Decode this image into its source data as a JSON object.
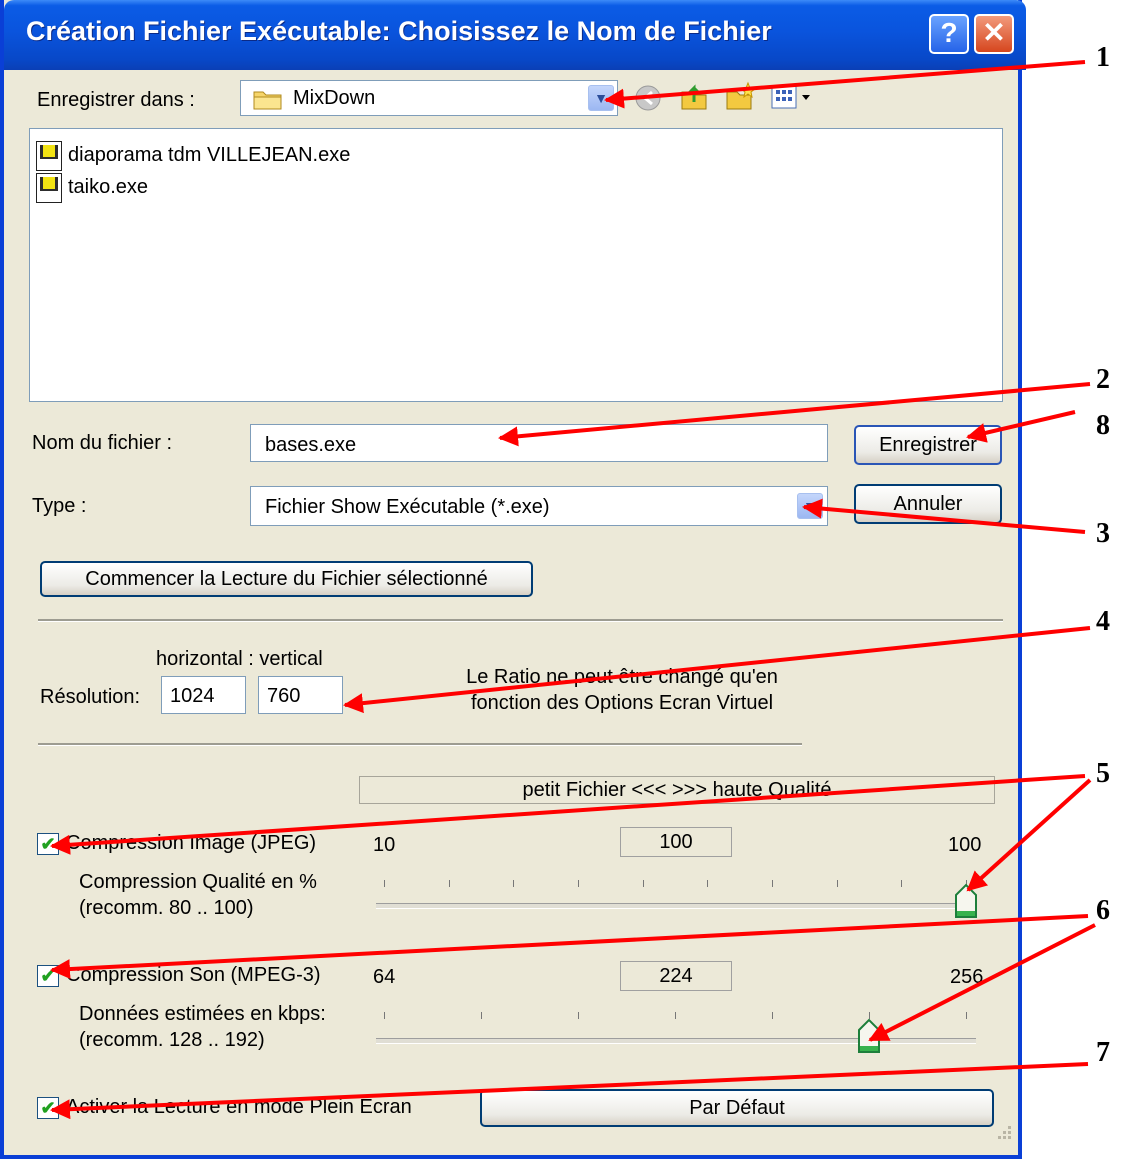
{
  "window": {
    "title": "Création Fichier Exécutable: Choisissez le Nom de Fichier",
    "help_glyph": "?",
    "close_glyph": "✕"
  },
  "save_in": {
    "label": "Enregistrer dans :",
    "folder": "MixDown",
    "icons": [
      "back-arrow-icon",
      "up-folder-icon",
      "new-folder-icon",
      "view-menu-icon"
    ]
  },
  "files": [
    "diaporama tdm VILLEJEAN.exe",
    "taiko.exe"
  ],
  "filename": {
    "label": "Nom du fichier :",
    "value": "bases.exe"
  },
  "type": {
    "label": "Type :",
    "value": "Fichier Show Exécutable (*.exe)"
  },
  "buttons": {
    "save": "Enregistrer",
    "cancel": "Annuler",
    "play": "Commencer la Lecture du Fichier sélectionné",
    "default": "Par Défaut"
  },
  "resolution": {
    "header": "horizontal : vertical",
    "label": "Résolution:",
    "horizontal": "1024",
    "vertical": "760",
    "note_line1": "Le Ratio ne peut être changé qu'en",
    "note_line2": "fonction des Options Ecran Virtuel"
  },
  "quality_bar": "petit Fichier  <<<     >>>  haute Qualité",
  "image_compression": {
    "label": "Compression Image (JPEG)",
    "checked": true,
    "min": "10",
    "value": "100",
    "max": "100",
    "desc1": "Compression Qualité en %",
    "desc2": "(recomm. 80 .. 100)",
    "slider_min": 10,
    "slider_max": 100,
    "slider_value": 100
  },
  "sound_compression": {
    "label": "Compression Son (MPEG-3)",
    "checked": true,
    "min": "64",
    "value": "224",
    "max": "256",
    "desc1": "Données estimées en kbps:",
    "desc2": "(recomm. 128 .. 192)",
    "slider_min": 64,
    "slider_max": 256,
    "slider_value": 224
  },
  "fullscreen": {
    "label": "Activer la Lecture en mode Plein Ecran",
    "checked": true
  },
  "annotations": [
    "1",
    "2",
    "3",
    "4",
    "5",
    "6",
    "7",
    "8"
  ],
  "colors": {
    "annotation_arrow": "#ff0000",
    "titlebar": "#0a54dd",
    "window_bg": "#ece9d8"
  }
}
